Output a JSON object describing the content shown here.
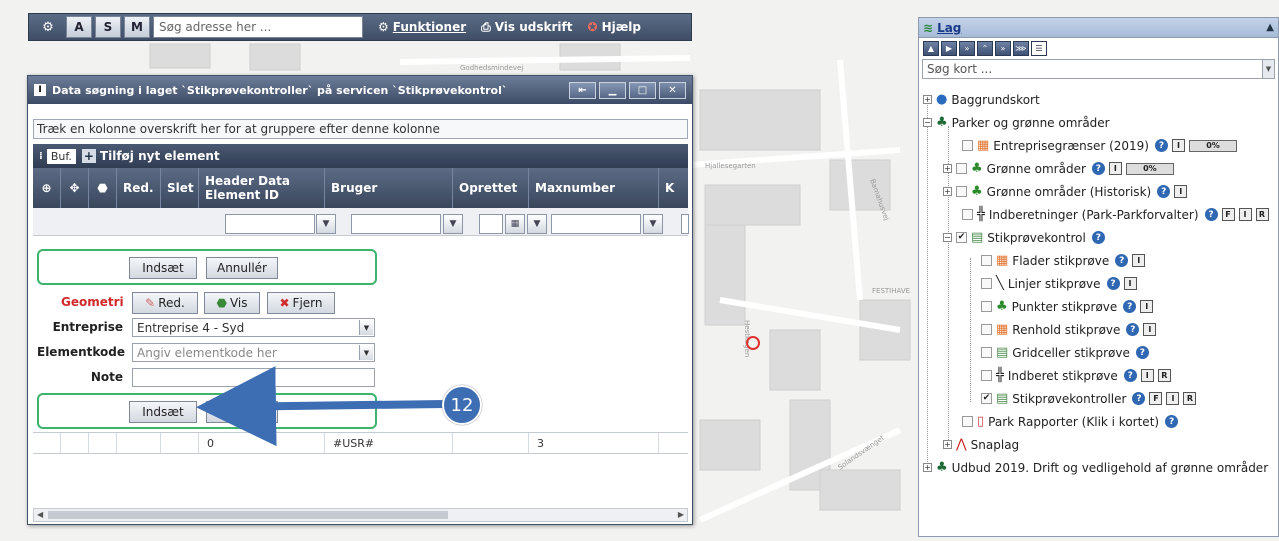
{
  "toolbar": {
    "btn_a": "A",
    "btn_s": "S",
    "btn_m": "M",
    "search_placeholder": "Søg adresse her ...",
    "funktioner": "Funktioner",
    "vis_udskrift": "Vis udskrift",
    "hjaelp": "Hjælp"
  },
  "map": {
    "street1": "Godhedsmindevej",
    "street2": "Hjallesegarten",
    "street3": "Barnahusvej",
    "street4": "Hestkagen",
    "street5": "FESTIHAVE",
    "street6": "Solandsvænget"
  },
  "dialog": {
    "title_icon": "I",
    "title": "Data søgning i laget `Stikprøvekontroller` på servicen `Stikprøvekontrol`",
    "group_hint": "Træk en kolonne overskrift her for at gruppere efter denne kolonne",
    "buf": "Buf.",
    "add_new": "Tilføj nyt element",
    "columns": [
      "Red.",
      "Slet",
      "Header Data Element ID",
      "Bruger",
      "Oprettet",
      "Maxnumber",
      "K"
    ],
    "insert": "Indsæt",
    "cancel": "Annullér",
    "geometri_label": "Geometri",
    "geo_red": "Red.",
    "geo_vis": "Vis",
    "geo_fjern": "Fjern",
    "entreprise_label": "Entreprise",
    "entreprise_value": "Entreprise 4 - Syd",
    "elementkode_label": "Elementkode",
    "elementkode_placeholder": "Angiv elementkode her",
    "note_label": "Note",
    "insert2": "Indsæt",
    "cancel2": "Annullér",
    "row": {
      "id": "0",
      "bruger": "#USR#",
      "maxnumber": "3"
    }
  },
  "callout": "12",
  "layers": {
    "title": "Lag",
    "search_placeholder": "Søg kort ...",
    "items": [
      {
        "label": "Baggrundskort"
      },
      {
        "label": "Parker og grønne områder"
      },
      {
        "label": "Entreprisegrænser (2019)",
        "pct": "0%"
      },
      {
        "label": "Grønne områder",
        "pct": "0%"
      },
      {
        "label": "Grønne områder (Historisk)"
      },
      {
        "label": "Indberetninger (Park-Parkforvalter)"
      },
      {
        "label": "Stikprøvekontrol"
      },
      {
        "label": "Flader stikprøve"
      },
      {
        "label": "Linjer stikprøve"
      },
      {
        "label": "Punkter stikprøve"
      },
      {
        "label": "Renhold stikprøve"
      },
      {
        "label": "Gridceller stikprøve"
      },
      {
        "label": "Indberet stikprøve"
      },
      {
        "label": "Stikprøvekontroller"
      },
      {
        "label": "Park Rapporter (Klik i kortet)"
      },
      {
        "label": "Snaplag"
      },
      {
        "label": "Udbud 2019. Drift og vedligehold af grønne områder"
      }
    ]
  },
  "colors": {
    "accent": "#3d6eb3",
    "green_box": "#3db36c",
    "geometri_red": "#d12a2a",
    "marker": "#e03030"
  }
}
